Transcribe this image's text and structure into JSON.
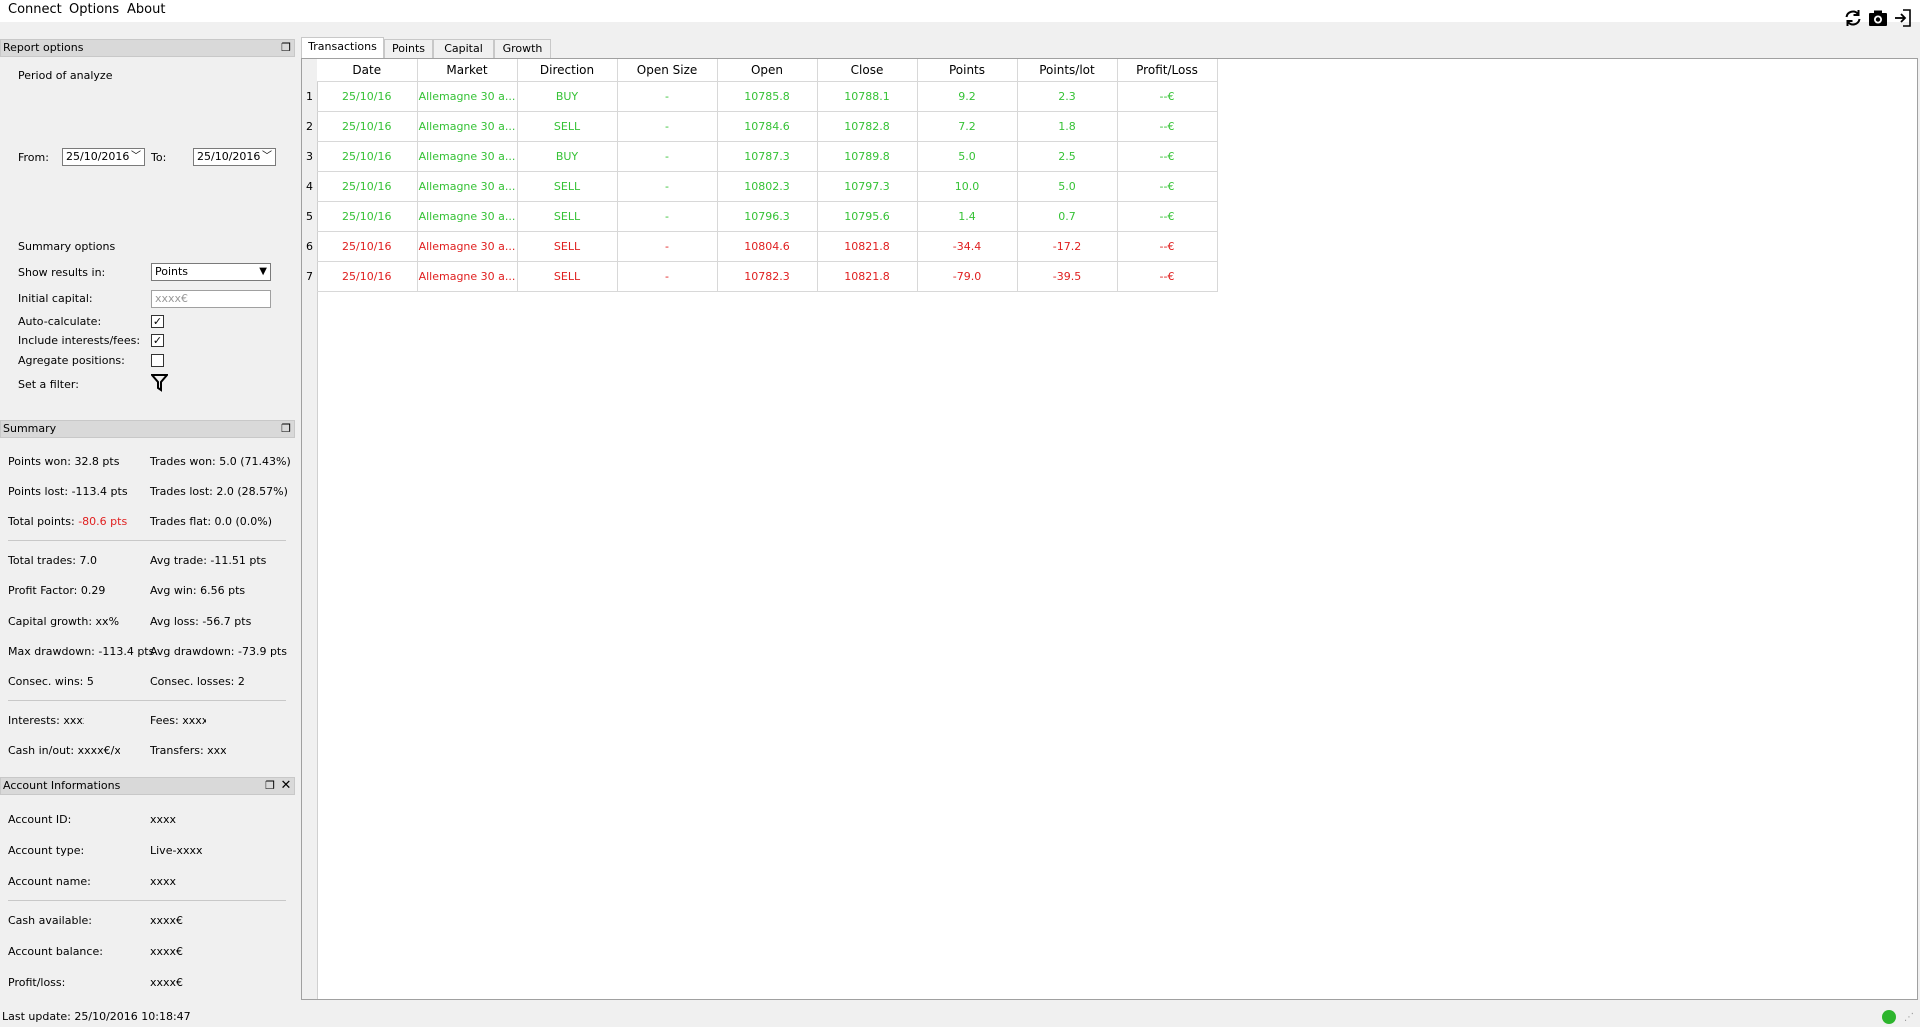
{
  "menu": {
    "connect": "Connect",
    "options": "Options",
    "about": "About"
  },
  "toolbar": {
    "icons": [
      "refresh-icon",
      "camera-icon",
      "exit-icon"
    ]
  },
  "report_options": {
    "title": "Report options",
    "period_label": "Period of analyze",
    "from_label": "From:",
    "from_value": "25/10/2016",
    "to_label": "To:",
    "to_value": "25/10/2016",
    "summary_options_label": "Summary options",
    "show_results_label": "Show results in:",
    "show_results_value": "Points",
    "initial_capital_label": "Initial capital:",
    "initial_capital_placeholder": "xxxx€",
    "auto_calculate_label": "Auto-calculate:",
    "auto_calculate_checked": true,
    "include_interests_label": "Include interests/fees:",
    "include_interests_checked": true,
    "aggregate_label": "Agregate positions:",
    "aggregate_checked": false,
    "filter_label": "Set a filter:"
  },
  "summary": {
    "title": "Summary",
    "points_won": "Points won: 32.8 pts",
    "trades_won": "Trades won: 5.0 (71.43%)",
    "points_lost": "Points lost: -113.4 pts",
    "trades_lost": "Trades lost: 2.0 (28.57%)",
    "total_points_label": "Total points: ",
    "total_points_value": "-80.6 pts",
    "trades_flat": "Trades flat: 0.0 (0.0%)",
    "total_trades": "Total trades: 7.0",
    "avg_trade": "Avg trade: -11.51 pts",
    "profit_factor": "Profit Factor: 0.29",
    "avg_win": "Avg win: 6.56 pts",
    "capital_growth": "Capital growth: xx%",
    "avg_loss": "Avg loss: -56.7 pts",
    "max_drawdown": "Max drawdown: -113.4 pts",
    "avg_drawdown": "Avg drawdown: -73.9 pts",
    "consec_wins": "Consec. wins: 5",
    "consec_losses": "Consec. losses: 2",
    "interests": "Interests: xxxx",
    "fees": "Fees: xxxx",
    "cash_inout": "Cash in/out: xxxx€/xx",
    "transfers": "Transfers: xxxx"
  },
  "account": {
    "title": "Account Informations",
    "id_label": "Account ID:",
    "id_value": "xxxx",
    "type_label": "Account type:",
    "type_value": "Live-xxxx",
    "name_label": "Account name:",
    "name_value": "xxxx",
    "cash_label": "Cash available:",
    "cash_value": "xxxx€",
    "balance_label": "Account balance:",
    "balance_value": "xxxx€",
    "pl_label": "Profit/loss:",
    "pl_value": "xxxx€"
  },
  "tabs": [
    "Transactions",
    "Points",
    "Capital",
    "Growth"
  ],
  "table": {
    "columns": [
      "Date",
      "Market",
      "Direction",
      "Open Size",
      "Open",
      "Close",
      "Points",
      "Points/lot",
      "Profit/Loss"
    ],
    "rows": [
      {
        "n": "1",
        "status": "g",
        "cells": [
          "25/10/16",
          "Allemagne 30 a...",
          "BUY",
          "-",
          "10785.8",
          "10788.1",
          "9.2",
          "2.3",
          "--€"
        ]
      },
      {
        "n": "2",
        "status": "g",
        "cells": [
          "25/10/16",
          "Allemagne 30 a...",
          "SELL",
          "-",
          "10784.6",
          "10782.8",
          "7.2",
          "1.8",
          "--€"
        ]
      },
      {
        "n": "3",
        "status": "g",
        "cells": [
          "25/10/16",
          "Allemagne 30 a...",
          "BUY",
          "-",
          "10787.3",
          "10789.8",
          "5.0",
          "2.5",
          "--€"
        ]
      },
      {
        "n": "4",
        "status": "g",
        "cells": [
          "25/10/16",
          "Allemagne 30 a...",
          "SELL",
          "-",
          "10802.3",
          "10797.3",
          "10.0",
          "5.0",
          "--€"
        ]
      },
      {
        "n": "5",
        "status": "g",
        "cells": [
          "25/10/16",
          "Allemagne 30 a...",
          "SELL",
          "-",
          "10796.3",
          "10795.6",
          "1.4",
          "0.7",
          "--€"
        ]
      },
      {
        "n": "6",
        "status": "r",
        "cells": [
          "25/10/16",
          "Allemagne 30 a...",
          "SELL",
          "-",
          "10804.6",
          "10821.8",
          "-34.4",
          "-17.2",
          "--€"
        ]
      },
      {
        "n": "7",
        "status": "r",
        "cells": [
          "25/10/16",
          "Allemagne 30 a...",
          "SELL",
          "-",
          "10782.3",
          "10821.8",
          "-79.0",
          "-39.5",
          "--€"
        ]
      }
    ]
  },
  "status": {
    "last_update": "Last update: 25/10/2016 10:18:47",
    "connection_color": "#2db52d"
  },
  "colors": {
    "positive": "#36c236",
    "negative": "#e02020"
  }
}
